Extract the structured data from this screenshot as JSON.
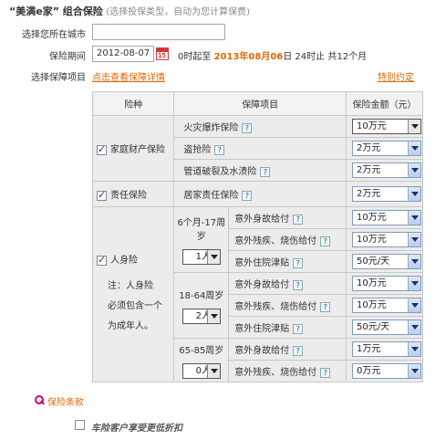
{
  "header": {
    "title": "“美满e家” 组合保险",
    "subtitle": "(选择投保类型，自动为您计算保费)"
  },
  "city": {
    "label": "选择您所在城市",
    "value": ""
  },
  "period": {
    "label": "保险期间",
    "date": "2012-08-07",
    "from_text": "0时起至",
    "end_year": "2013",
    "y_unit": "年",
    "end_month": "08",
    "m_unit": "月",
    "end_day": "06",
    "to_text": "日 24时止  共",
    "months": "12",
    "months_unit": "个月"
  },
  "project": {
    "label": "选择保障项目",
    "link": "点击查看保障详情",
    "special": "特别约定"
  },
  "table": {
    "headers": [
      "险种",
      "保障项目",
      "保险金额（元）"
    ],
    "property": {
      "name": "家庭财产保险",
      "checked": true,
      "items": [
        {
          "name": "火灾爆炸保险",
          "amount": "10万元"
        },
        {
          "name": "盗抢险",
          "amount": "2万元"
        },
        {
          "name": "管道破裂及水渍险",
          "amount": "2万元"
        }
      ]
    },
    "liability": {
      "name": "责任保险",
      "checked": true,
      "item": "居家责任保险",
      "amount": "2万元"
    },
    "personal": {
      "name": "人身险",
      "checked": true,
      "note_lines": [
        "注：人身险",
        "必须包含一个",
        "为成年人。"
      ],
      "groups": [
        {
          "age": "6个月-17周岁",
          "count": "1人",
          "items": [
            {
              "name": "意外身故给付",
              "amount": "10万元"
            },
            {
              "name": "意外残疾、烧伤给付",
              "amount": "10万元"
            },
            {
              "name": "意外住院津贴",
              "amount": "50元/天"
            }
          ]
        },
        {
          "age": "18-64周岁",
          "count": "2人",
          "items": [
            {
              "name": "意外身故给付",
              "amount": "10万元"
            },
            {
              "name": "意外残疾、烧伤给付",
              "amount": "10万元"
            },
            {
              "name": "意外住院津贴",
              "amount": "50元/天"
            }
          ]
        },
        {
          "age": "65-85周岁",
          "count": "0人",
          "items": [
            {
              "name": "意外身故给付",
              "amount": "1万元"
            },
            {
              "name": "意外残疾、烧伤给付",
              "amount": "0万元"
            }
          ]
        }
      ]
    }
  },
  "terms_link": "保险条款",
  "discount": {
    "label": "车险客户享受更低折扣",
    "checked": false
  },
  "colors": {
    "accent": "#e06600",
    "border": "#c8c8c8",
    "row_bg": "#ececec"
  }
}
